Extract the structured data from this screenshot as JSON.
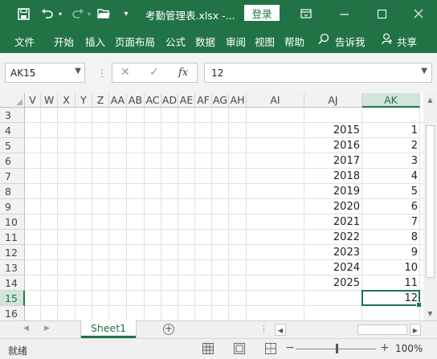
{
  "titlebar": {
    "filename": "考勤管理表.xlsx  -...",
    "login_label": "登录",
    "icons": [
      "save-icon",
      "undo-icon",
      "redo-icon",
      "open-icon",
      "customize-icon",
      "ribbon-display-icon",
      "minimize-icon",
      "maximize-icon",
      "close-icon"
    ]
  },
  "ribbon": {
    "tabs": [
      "文件",
      "开始",
      "插入",
      "页面布局",
      "公式",
      "数据",
      "审阅",
      "视图",
      "帮助"
    ],
    "tell_me": "告诉我",
    "share": "共享"
  },
  "formula_bar": {
    "name_box": "AK15",
    "formula_value": "12",
    "fx_label": "fx"
  },
  "grid": {
    "columns": [
      "V",
      "W",
      "X",
      "Y",
      "Z",
      "AA",
      "AB",
      "AC",
      "AD",
      "AE",
      "AF",
      "AG",
      "AH",
      "AI",
      "AJ",
      "AK"
    ],
    "selected_column": "AK",
    "rows": [
      "3",
      "4",
      "5",
      "6",
      "7",
      "8",
      "9",
      "10",
      "11",
      "12",
      "13",
      "14",
      "15",
      "16"
    ],
    "selected_row": "15",
    "aj_values": [
      "",
      "2015",
      "2016",
      "2017",
      "2018",
      "2019",
      "2020",
      "2021",
      "2022",
      "2023",
      "2024",
      "2025",
      "",
      ""
    ],
    "ak_values": [
      "",
      "1",
      "2",
      "3",
      "4",
      "5",
      "6",
      "7",
      "8",
      "9",
      "10",
      "11",
      "12",
      ""
    ]
  },
  "sheets": {
    "tabs": [
      "Sheet1"
    ],
    "active": "Sheet1"
  },
  "status": {
    "mode": "就绪",
    "zoom": "100%"
  }
}
